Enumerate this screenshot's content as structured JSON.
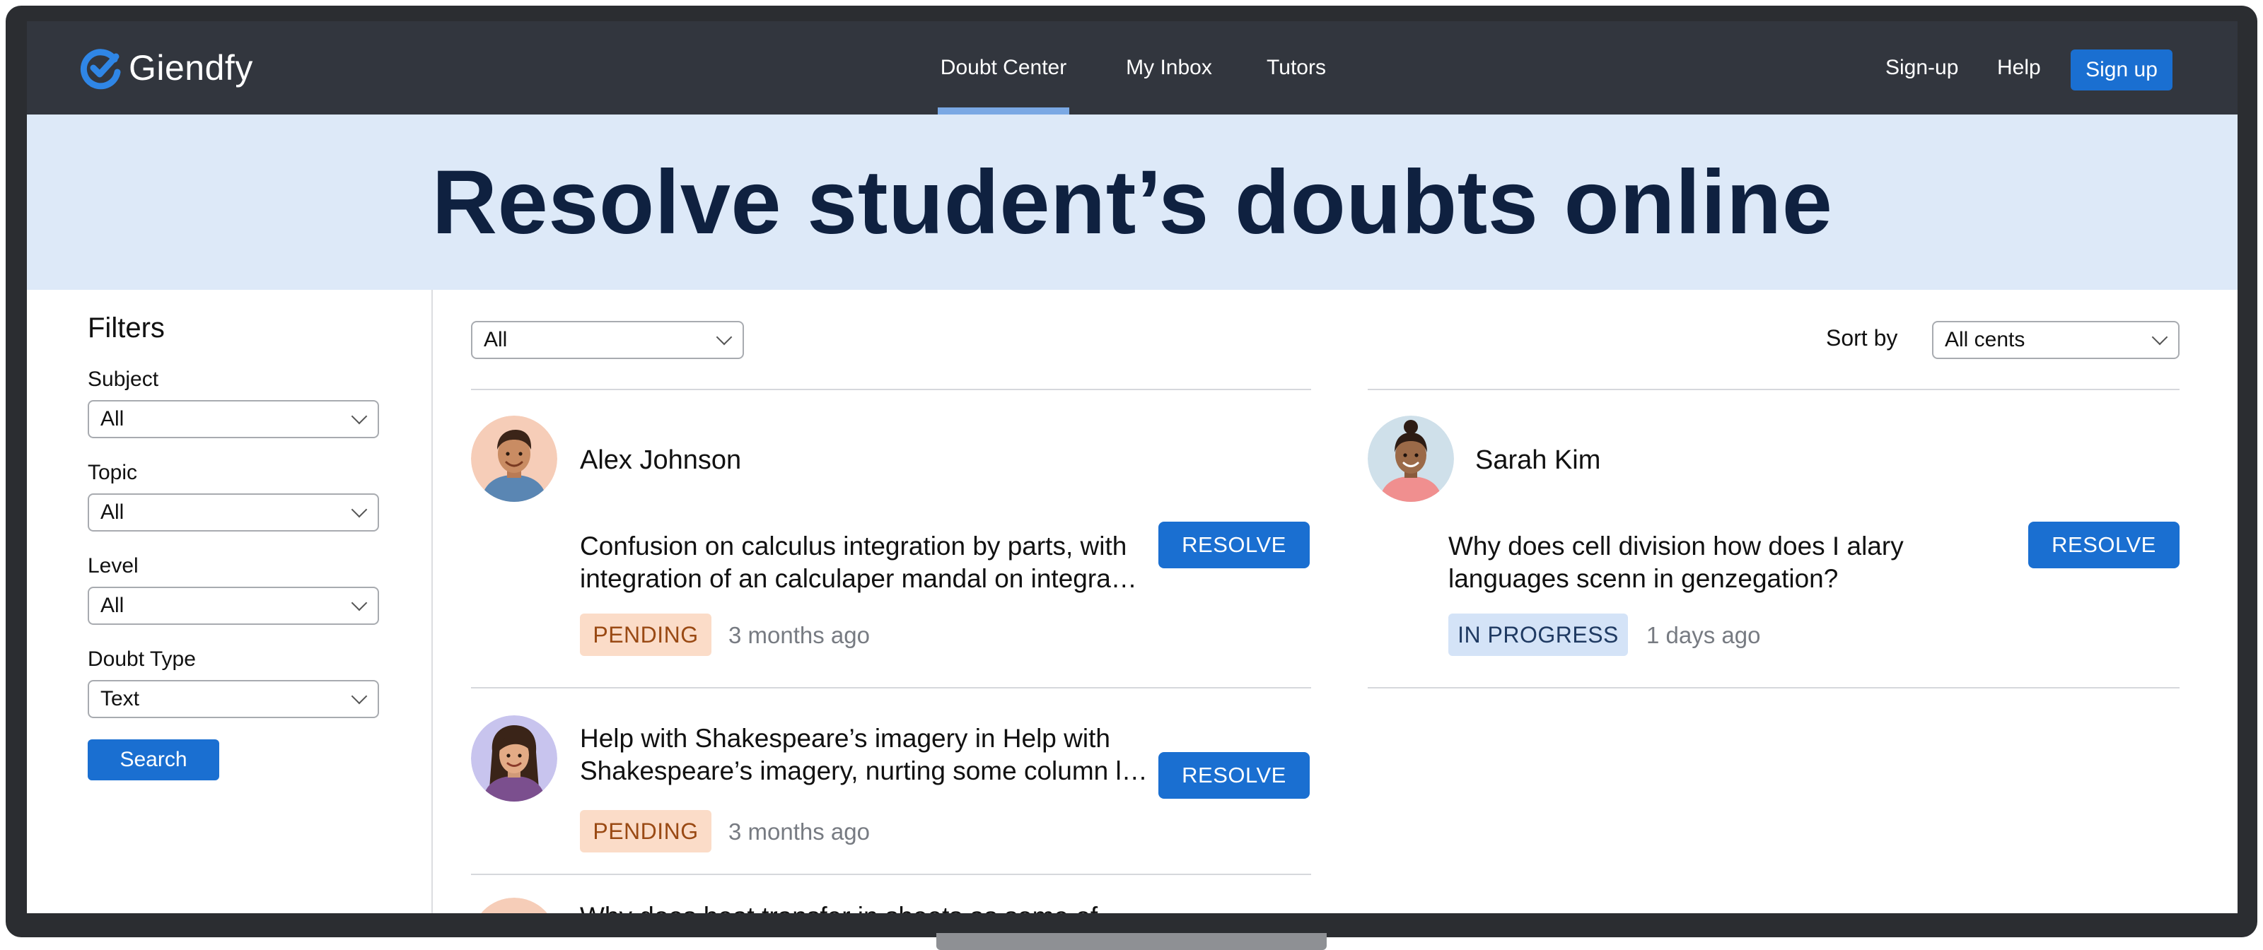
{
  "brand": {
    "name": "Giendfy",
    "color": "#1a6fd1"
  },
  "nav": {
    "links": [
      {
        "label": "Doubt Center",
        "active": true
      },
      {
        "label": "My Inbox",
        "active": false
      },
      {
        "label": "Tutors",
        "active": false
      }
    ],
    "right": {
      "signup_link": "Sign-up",
      "help": "Help",
      "signup_button": "Sign up"
    }
  },
  "hero": {
    "title": "Resolve student’s doubts online"
  },
  "filters": {
    "title": "Filters",
    "subject": {
      "label": "Subject",
      "value": "All"
    },
    "topic": {
      "label": "Topic",
      "value": "All"
    },
    "level": {
      "label": "Level",
      "value": "All"
    },
    "doubt_type": {
      "label": "Doubt Type",
      "value": "Text"
    },
    "search_button": "Search"
  },
  "toolbar": {
    "status_filter": "All",
    "sort_label": "Sort by",
    "sort_value": "All cents"
  },
  "doubts": [
    {
      "name": "Alex Johnson",
      "question_line1": "Confusion on calculus integration by parts, with",
      "question_line2": "integration of an calculaper mandal on integration by parts",
      "status": "PENDING",
      "time": "3 months ago",
      "action": "RESOLVE",
      "avatar": "male-avatar-icon"
    },
    {
      "name": "Sarah Kim",
      "question_line1": "Why does cell division how does I alary",
      "question_line2": "languages scenn in genzegation?",
      "status": "IN PROGRESS",
      "time": "1 days ago",
      "action": "RESOLVE",
      "avatar": "female-avatar-icon"
    },
    {
      "name": "",
      "question_line1": "Help with Shakespeare’s imagery in Help with",
      "question_line2": "Shakespeare’s imagery, nurting some column layouts",
      "status": "PENDING",
      "time": "3 months ago",
      "action": "RESOLVE",
      "avatar": "female-avatar-icon"
    }
  ],
  "partial_row_text": "Why does heat transfer in sheets as some of",
  "colors": {
    "navbar": "#32363e",
    "hero_bg": "#dde9f8",
    "hero_text": "#0f2140",
    "primary": "#1a6fd1",
    "pending_bg": "#fbdcc8",
    "pending_text": "#9a4a14",
    "progress_bg": "#d4e3f7",
    "progress_text": "#1f3a62"
  }
}
